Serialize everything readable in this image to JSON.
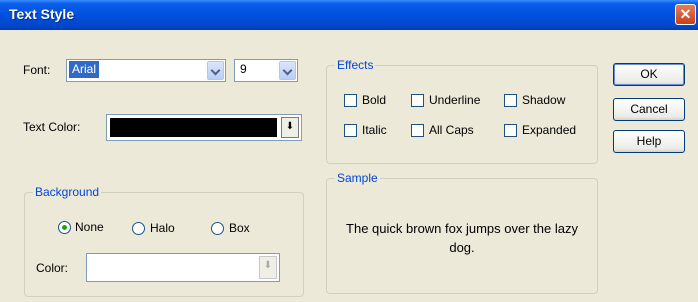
{
  "window": {
    "title": "Text Style",
    "close_glyph": "✕"
  },
  "font": {
    "label": "Font:",
    "value": "Arial",
    "size_value": "9"
  },
  "text_color": {
    "label": "Text Color:",
    "color": "#000000",
    "arrow_glyph": "⬇"
  },
  "background": {
    "title": "Background",
    "options": [
      "None",
      "Halo",
      "Box"
    ],
    "selected": "None",
    "color_label": "Color:",
    "arrow_glyph": "⬇"
  },
  "effects": {
    "title": "Effects",
    "items": [
      "Bold",
      "Underline",
      "Shadow",
      "Italic",
      "All Caps",
      "Expanded"
    ]
  },
  "sample": {
    "title": "Sample",
    "text": "The quick brown fox jumps over the lazy dog."
  },
  "buttons": {
    "ok": "OK",
    "cancel": "Cancel",
    "help": "Help"
  }
}
